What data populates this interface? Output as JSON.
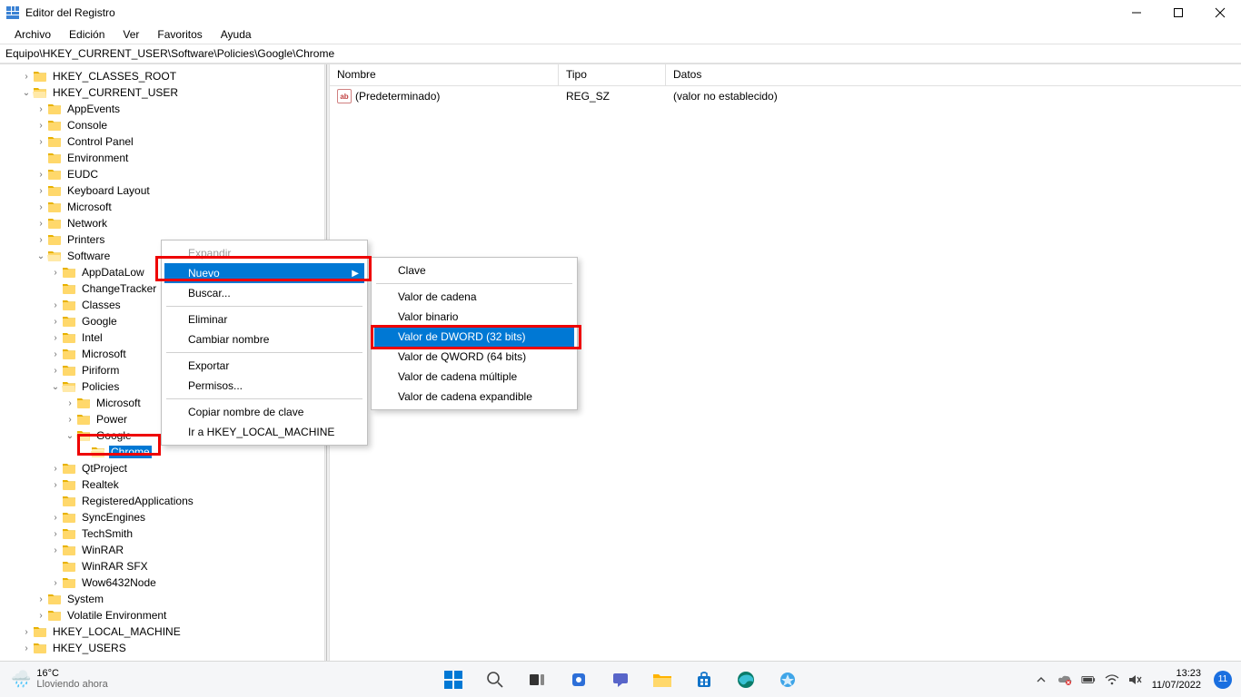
{
  "window": {
    "title": "Editor del Registro"
  },
  "menu": {
    "items": [
      "Archivo",
      "Edición",
      "Ver",
      "Favoritos",
      "Ayuda"
    ]
  },
  "path": "Equipo\\HKEY_CURRENT_USER\\Software\\Policies\\Google\\Chrome",
  "tree": {
    "root": "Equipo",
    "hives": [
      {
        "name": "HKEY_CLASSES_ROOT",
        "indent": 1,
        "twisty": ">",
        "open": false
      },
      {
        "name": "HKEY_CURRENT_USER",
        "indent": 1,
        "twisty": "v",
        "open": true,
        "children": [
          {
            "name": "AppEvents",
            "indent": 2,
            "twisty": ">"
          },
          {
            "name": "Console",
            "indent": 2,
            "twisty": ">"
          },
          {
            "name": "Control Panel",
            "indent": 2,
            "twisty": ">"
          },
          {
            "name": "Environment",
            "indent": 2,
            "twisty": ""
          },
          {
            "name": "EUDC",
            "indent": 2,
            "twisty": ">"
          },
          {
            "name": "Keyboard Layout",
            "indent": 2,
            "twisty": ">"
          },
          {
            "name": "Microsoft",
            "indent": 2,
            "twisty": ">"
          },
          {
            "name": "Network",
            "indent": 2,
            "twisty": ">"
          },
          {
            "name": "Printers",
            "indent": 2,
            "twisty": ">"
          },
          {
            "name": "Software",
            "indent": 2,
            "twisty": "v",
            "open": true,
            "children": [
              {
                "name": "AppDataLow",
                "indent": 3,
                "twisty": ">"
              },
              {
                "name": "ChangeTracker",
                "indent": 3,
                "twisty": ""
              },
              {
                "name": "Classes",
                "indent": 3,
                "twisty": ">"
              },
              {
                "name": "Google",
                "indent": 3,
                "twisty": ">"
              },
              {
                "name": "Intel",
                "indent": 3,
                "twisty": ">"
              },
              {
                "name": "Microsoft",
                "indent": 3,
                "twisty": ">"
              },
              {
                "name": "Piriform",
                "indent": 3,
                "twisty": ">"
              },
              {
                "name": "Policies",
                "indent": 3,
                "twisty": "v",
                "open": true,
                "children": [
                  {
                    "name": "Microsoft",
                    "indent": 4,
                    "twisty": ">"
                  },
                  {
                    "name": "Power",
                    "indent": 4,
                    "twisty": ">"
                  },
                  {
                    "name": "Google",
                    "indent": 4,
                    "twisty": "v",
                    "open": true,
                    "children": [
                      {
                        "name": "Chrome",
                        "indent": 5,
                        "twisty": "",
                        "selected": true
                      }
                    ]
                  }
                ]
              },
              {
                "name": "QtProject",
                "indent": 3,
                "twisty": ">"
              },
              {
                "name": "Realtek",
                "indent": 3,
                "twisty": ">"
              },
              {
                "name": "RegisteredApplications",
                "indent": 3,
                "twisty": ""
              },
              {
                "name": "SyncEngines",
                "indent": 3,
                "twisty": ">"
              },
              {
                "name": "TechSmith",
                "indent": 3,
                "twisty": ">"
              },
              {
                "name": "WinRAR",
                "indent": 3,
                "twisty": ">"
              },
              {
                "name": "WinRAR SFX",
                "indent": 3,
                "twisty": ""
              },
              {
                "name": "Wow6432Node",
                "indent": 3,
                "twisty": ">"
              }
            ]
          },
          {
            "name": "System",
            "indent": 2,
            "twisty": ">"
          },
          {
            "name": "Volatile Environment",
            "indent": 2,
            "twisty": ">"
          }
        ]
      },
      {
        "name": "HKEY_LOCAL_MACHINE",
        "indent": 1,
        "twisty": ">"
      },
      {
        "name": "HKEY_USERS",
        "indent": 1,
        "twisty": ">"
      }
    ]
  },
  "values": {
    "headers": {
      "name": "Nombre",
      "type": "Tipo",
      "data": "Datos"
    },
    "rows": [
      {
        "name": "(Predeterminado)",
        "type": "REG_SZ",
        "data": "(valor no establecido)",
        "icon": "ab"
      }
    ]
  },
  "context_menu": {
    "items": [
      {
        "label": "Expandir",
        "disabled": true
      },
      {
        "label": "Nuevo",
        "hover": true,
        "submenu_arrow": true
      },
      {
        "label": "Buscar..."
      },
      {
        "sep": true
      },
      {
        "label": "Eliminar"
      },
      {
        "label": "Cambiar nombre"
      },
      {
        "sep": true
      },
      {
        "label": "Exportar"
      },
      {
        "label": "Permisos..."
      },
      {
        "sep": true
      },
      {
        "label": "Copiar nombre de clave"
      },
      {
        "label": "Ir a HKEY_LOCAL_MACHINE"
      }
    ]
  },
  "submenu": {
    "items": [
      {
        "label": "Clave"
      },
      {
        "sep": true
      },
      {
        "label": "Valor de cadena"
      },
      {
        "label": "Valor binario"
      },
      {
        "label": "Valor de DWORD (32 bits)",
        "hover": true
      },
      {
        "label": "Valor de QWORD (64 bits)"
      },
      {
        "label": "Valor de cadena múltiple"
      },
      {
        "label": "Valor de cadena expandible"
      }
    ]
  },
  "taskbar": {
    "weather": {
      "temp": "16°C",
      "desc": "Lloviendo ahora"
    },
    "clock": {
      "time": "13:23",
      "date": "11/07/2022"
    },
    "notif_count": "11"
  }
}
